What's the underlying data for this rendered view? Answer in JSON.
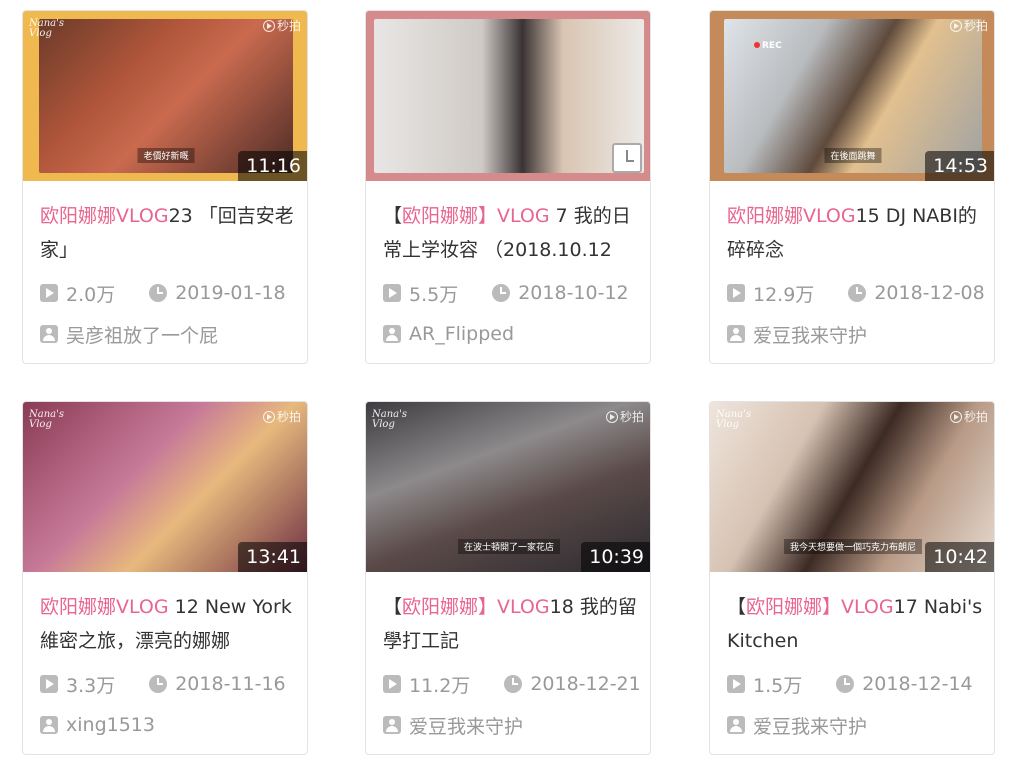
{
  "colors": {
    "highlight": "#e8658f",
    "meta_text": "#999999",
    "title_text": "#333333",
    "card_border": "#e3e3e3"
  },
  "cards": [
    {
      "title_prefix": "",
      "title_hl": "欧阳娜娜VLOG",
      "title_rest": "23 「回吉安老家」",
      "duration": "11:16",
      "views": "2.0万",
      "date": "2019-01-18",
      "author": "吴彦祖放了一个屁",
      "thumb_bg": "#f0b94f",
      "thumb_inner": "#b0563a",
      "subtitle": "老價好新嘅",
      "watermark": "秒拍"
    },
    {
      "title_prefix": "【",
      "title_hl": "欧阳娜娜】VLOG",
      "title_rest": " 7 我的日常上学妆容 （2018.10.12",
      "duration": "",
      "views": "5.5万",
      "date": "2018-10-12",
      "author": "AR_Flipped",
      "thumb_bg": "#d58b8b",
      "thumb_inner": "#c9c6c4",
      "subtitle": "",
      "watermark": ""
    },
    {
      "title_prefix": "",
      "title_hl": "欧阳娜娜VLOG",
      "title_rest": "15 DJ NABI的碎碎念",
      "duration": "14:53",
      "views": "12.9万",
      "date": "2018-12-08",
      "author": "爱豆我来守护",
      "thumb_bg": "#c58a5a",
      "thumb_inner": "#8f8c88",
      "subtitle": "在後面跳舞",
      "watermark": "秒拍",
      "rec": "REC"
    },
    {
      "title_prefix": "",
      "title_hl": "欧阳娜娜VLOG",
      "title_rest": " 12 New York 維密之旅，漂亮的娜娜",
      "duration": "13:41",
      "views": "3.3万",
      "date": "2018-11-16",
      "author": "xing1513",
      "thumb_bg": "#b86a88",
      "thumb_inner": "#9c5e75",
      "subtitle": "",
      "watermark": "秒拍"
    },
    {
      "title_prefix": "【",
      "title_hl": "欧阳娜娜】VLOG",
      "title_rest": "18 我的留學打工記",
      "duration": "10:39",
      "views": "11.2万",
      "date": "2018-12-21",
      "author": "爱豆我来守护",
      "thumb_bg": "#5b5a62",
      "thumb_inner": "#7b7474",
      "subtitle": "在波士頓開了一家花店",
      "watermark": "秒拍"
    },
    {
      "title_prefix": "【",
      "title_hl": "欧阳娜娜】VLOG",
      "title_rest": "17 Nabi's Kitchen",
      "duration": "10:42",
      "views": "1.5万",
      "date": "2018-12-14",
      "author": "爱豆我来守护",
      "thumb_bg": "#d9c9bd",
      "thumb_inner": "#a98773",
      "subtitle": "我今天想要做一個巧克力布朗尼",
      "watermark": "秒拍"
    }
  ]
}
